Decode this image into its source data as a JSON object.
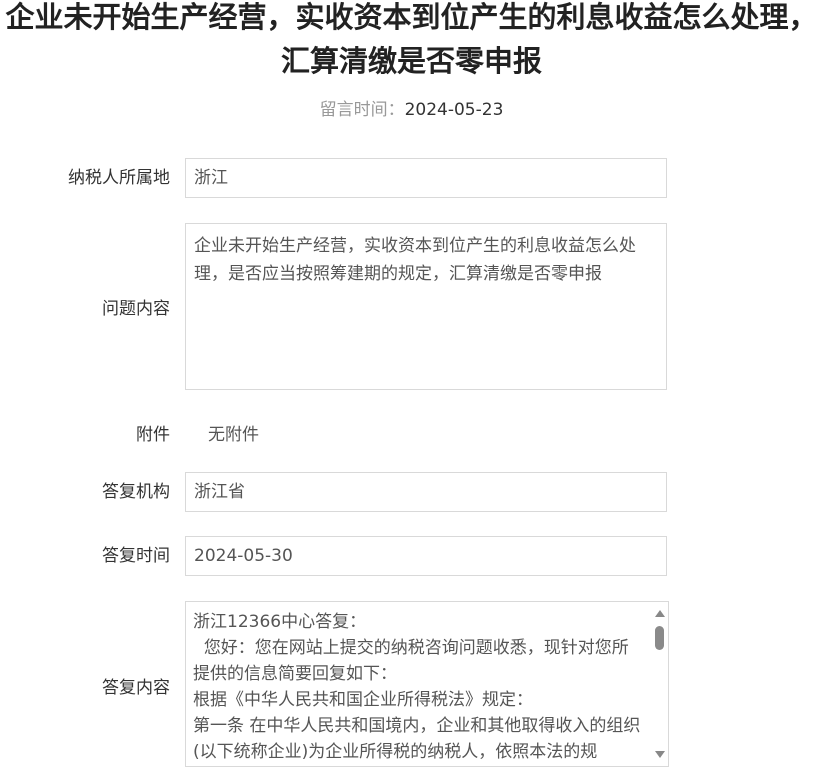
{
  "title": {
    "line1": "企业未开始生产经营，实收资本到位产生的利息收益怎么处理，",
    "line2": "汇算清缴是否零申报"
  },
  "meta": {
    "label": "留言时间：",
    "value": "2024-05-23"
  },
  "form": {
    "region": {
      "label": "纳税人所属地",
      "value": "浙江"
    },
    "question": {
      "label": "问题内容",
      "value": "企业未开始生产经营，实收资本到位产生的利息收益怎么处理，是否应当按照筹建期的规定，汇算清缴是否零申报"
    },
    "attachment": {
      "label": "附件",
      "value": "无附件"
    },
    "agency": {
      "label": "答复机构",
      "value": "浙江省"
    },
    "reply_time": {
      "label": "答复时间",
      "value": "2024-05-30"
    },
    "reply": {
      "label": "答复内容",
      "value": "浙江12366中心答复：\n  您好：您在网站上提交的纳税咨询问题收悉，现针对您所提供的信息简要回复如下：\n根据《中华人民共和国企业所得税法》规定：\n第一条 在中华人民共和国境内，企业和其他取得收入的组织(以下统称企业)为企业所得税的纳税人，依照本法的规"
    }
  },
  "icons": {
    "scroll_up": "scroll-up-arrow-icon",
    "scroll_down": "scroll-down-arrow-icon"
  }
}
